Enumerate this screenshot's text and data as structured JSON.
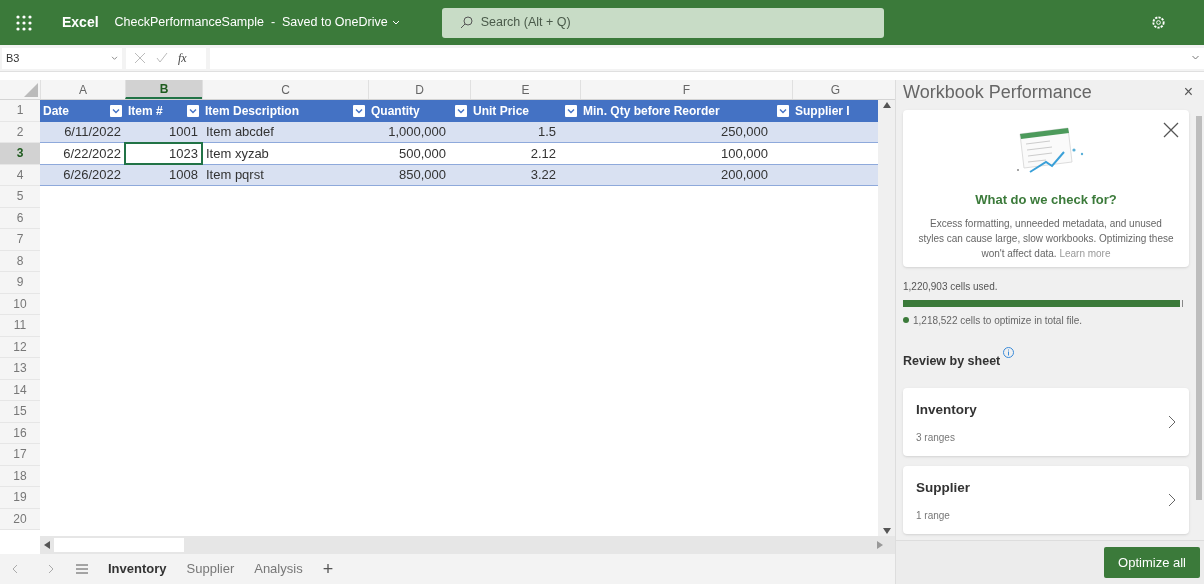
{
  "app": {
    "name": "Excel",
    "file_title": "CheckPerformanceSample  -  Saved to OneDrive",
    "search_placeholder": "Search (Alt + Q)"
  },
  "formula_bar": {
    "name_box": "B3",
    "fx": "fx"
  },
  "column_headers": [
    {
      "label": "A",
      "selected": false
    },
    {
      "label": "B",
      "selected": true
    },
    {
      "label": "C",
      "selected": false
    },
    {
      "label": "D",
      "selected": false
    },
    {
      "label": "E",
      "selected": false
    },
    {
      "label": "F",
      "selected": false
    },
    {
      "label": "G",
      "selected": false
    }
  ],
  "row_numbers": [
    {
      "label": "1",
      "selected": false
    },
    {
      "label": "2",
      "selected": false
    },
    {
      "label": "3",
      "selected": true
    },
    {
      "label": "4",
      "selected": false
    },
    {
      "label": "5",
      "selected": false
    },
    {
      "label": "6",
      "selected": false
    },
    {
      "label": "7",
      "selected": false
    },
    {
      "label": "8",
      "selected": false
    },
    {
      "label": "9",
      "selected": false
    },
    {
      "label": "10",
      "selected": false
    },
    {
      "label": "11",
      "selected": false
    },
    {
      "label": "12",
      "selected": false
    },
    {
      "label": "13",
      "selected": false
    },
    {
      "label": "14",
      "selected": false
    },
    {
      "label": "15",
      "selected": false
    },
    {
      "label": "16",
      "selected": false
    },
    {
      "label": "17",
      "selected": false
    },
    {
      "label": "18",
      "selected": false
    },
    {
      "label": "19",
      "selected": false
    },
    {
      "label": "20",
      "selected": false
    }
  ],
  "table": {
    "columns": [
      "Date",
      "Item #",
      "Item Description",
      "Quantity",
      "Unit Price",
      "Min. Qty before Reorder",
      "Supplier I"
    ],
    "rows": [
      {
        "cells": [
          {
            "text": "6/11/2022",
            "selected": false
          },
          {
            "text": "1001",
            "selected": false
          },
          {
            "text": "Item abcdef",
            "selected": false
          },
          {
            "text": "1,000,000",
            "selected": false
          },
          {
            "text": "1.5",
            "selected": false
          },
          {
            "text": "250,000",
            "selected": false
          }
        ]
      },
      {
        "cells": [
          {
            "text": "6/22/2022",
            "selected": false
          },
          {
            "text": "1023",
            "selected": true
          },
          {
            "text": "Item xyzab",
            "selected": false
          },
          {
            "text": "500,000",
            "selected": false
          },
          {
            "text": "2.12",
            "selected": false
          },
          {
            "text": "100,000",
            "selected": false
          }
        ]
      },
      {
        "cells": [
          {
            "text": "6/26/2022",
            "selected": false
          },
          {
            "text": "1008",
            "selected": false
          },
          {
            "text": "Item pqrst",
            "selected": false
          },
          {
            "text": "850,000",
            "selected": false
          },
          {
            "text": "3.22",
            "selected": false
          },
          {
            "text": "200,000",
            "selected": false
          }
        ]
      }
    ]
  },
  "sheet_tabs": [
    {
      "label": "Inventory",
      "selected": true
    },
    {
      "label": "Supplier",
      "selected": false
    },
    {
      "label": "Analysis",
      "selected": false
    }
  ],
  "add_sheet": "+",
  "panel": {
    "title": "Workbook Performance",
    "close": "×",
    "info_card": {
      "heading": "What do we check for?",
      "text": "Excess formatting, unneeded metadata, and unused styles can cause large, slow workbooks. Optimizing these won't affect data.",
      "link": "Learn more"
    },
    "cells_used": "1,220,903 cells used.",
    "usage": {
      "level": 0.99
    },
    "to_optimize": "1,218,522 cells to optimize in total file.",
    "review_heading": "Review by sheet",
    "sheets": [
      {
        "name": "Inventory",
        "detail": "3 ranges"
      },
      {
        "name": "Supplier",
        "detail": "1 range"
      }
    ],
    "button": "Optimize all"
  }
}
